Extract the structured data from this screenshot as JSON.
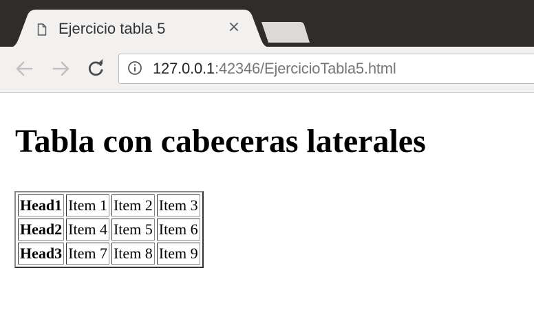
{
  "browser": {
    "tab": {
      "title": "Ejercicio tabla 5",
      "close_glyph": "×",
      "icon": "document-icon"
    },
    "toolbar": {
      "back_icon": "back-arrow-icon",
      "forward_icon": "forward-arrow-icon",
      "reload_icon": "reload-icon",
      "info_icon": "info-icon"
    },
    "address": {
      "host": "127.0.0.1",
      "rest": ":42346/EjercicioTabla5.html"
    },
    "colors": {
      "titlebar": "#2f2d2b",
      "toolbar": "#f2f1f0",
      "tab": "#f2f1f0",
      "new_tab": "#dcdad7"
    }
  },
  "page": {
    "title": "Tabla con cabeceras laterales",
    "table": {
      "rows": [
        {
          "header": "Head1",
          "cells": [
            "Item 1",
            "Item 2",
            "Item 3"
          ]
        },
        {
          "header": "Head2",
          "cells": [
            "Item 4",
            "Item 5",
            "Item 6"
          ]
        },
        {
          "header": "Head3",
          "cells": [
            "Item 7",
            "Item 8",
            "Item 9"
          ]
        }
      ]
    }
  }
}
